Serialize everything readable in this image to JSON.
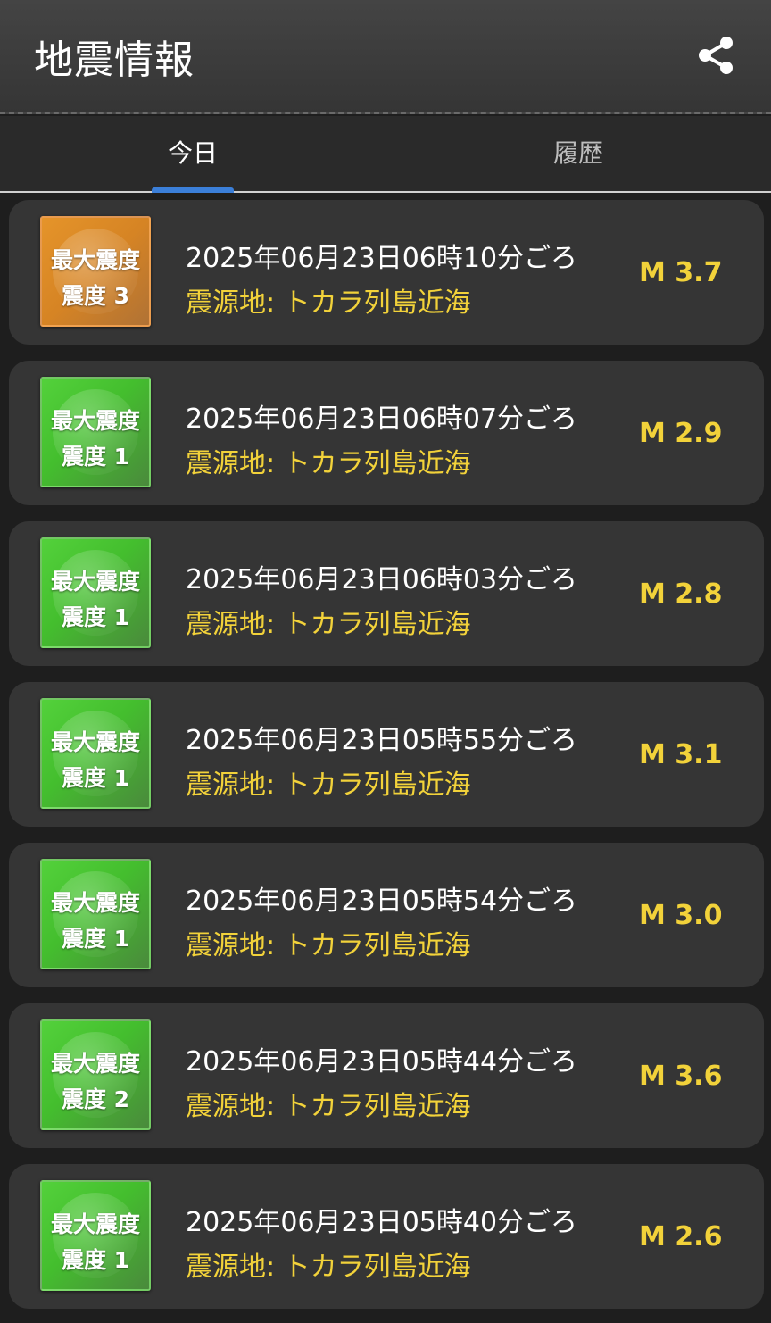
{
  "app": {
    "title": "地震情報",
    "share_icon": "share-icon"
  },
  "tabs": [
    {
      "label": "今日",
      "active": true
    },
    {
      "label": "履歴",
      "active": false
    }
  ],
  "colors": {
    "accent": "#3b7fd9",
    "highlight": "#f2d23a",
    "badge_green": "#4cc83a",
    "badge_orange": "#e08a2a"
  },
  "earthquakes": [
    {
      "badge_line1": "最大震度",
      "badge_line2": "震度 3",
      "level": "orange",
      "time": "2025年06月23日06時10分ごろ",
      "epicenter": "震源地: トカラ列島近海",
      "magnitude": "M 3.7"
    },
    {
      "badge_line1": "最大震度",
      "badge_line2": "震度 1",
      "level": "green",
      "time": "2025年06月23日06時07分ごろ",
      "epicenter": "震源地: トカラ列島近海",
      "magnitude": "M 2.9"
    },
    {
      "badge_line1": "最大震度",
      "badge_line2": "震度 1",
      "level": "green",
      "time": "2025年06月23日06時03分ごろ",
      "epicenter": "震源地: トカラ列島近海",
      "magnitude": "M 2.8"
    },
    {
      "badge_line1": "最大震度",
      "badge_line2": "震度 1",
      "level": "green",
      "time": "2025年06月23日05時55分ごろ",
      "epicenter": "震源地: トカラ列島近海",
      "magnitude": "M 3.1"
    },
    {
      "badge_line1": "最大震度",
      "badge_line2": "震度 1",
      "level": "green",
      "time": "2025年06月23日05時54分ごろ",
      "epicenter": "震源地: トカラ列島近海",
      "magnitude": "M 3.0"
    },
    {
      "badge_line1": "最大震度",
      "badge_line2": "震度 2",
      "level": "green",
      "time": "2025年06月23日05時44分ごろ",
      "epicenter": "震源地: トカラ列島近海",
      "magnitude": "M 3.6"
    },
    {
      "badge_line1": "最大震度",
      "badge_line2": "震度 1",
      "level": "green",
      "time": "2025年06月23日05時40分ごろ",
      "epicenter": "震源地: トカラ列島近海",
      "magnitude": "M 2.6"
    }
  ]
}
